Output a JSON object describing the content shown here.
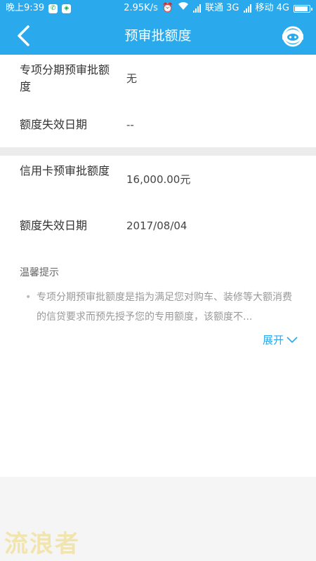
{
  "status_bar": {
    "time": "晚上9:39",
    "speed": "2.95K/s",
    "carrier1": "联通 3G",
    "carrier2": "移动 4G"
  },
  "header": {
    "title": "预审批额度"
  },
  "section1": {
    "items": [
      {
        "label": "专项分期预审批额度",
        "value": "无"
      },
      {
        "label": "额度失效日期",
        "value": "--"
      }
    ]
  },
  "section2": {
    "items": [
      {
        "label": "信用卡预审批额度",
        "value": "16,000.00元"
      },
      {
        "label": "额度失效日期",
        "value": "2017/08/04"
      }
    ],
    "tips_title": "温馨提示",
    "tips_text": "专项分期预审批额度是指为满足您对购车、装修等大额消费的信贷要求而预先授予您的专用额度，该额度不...",
    "expand_label": "展开"
  },
  "watermark": "流浪者",
  "colors": {
    "primary": "#2aa9ec",
    "background": "#f5f5f5"
  }
}
